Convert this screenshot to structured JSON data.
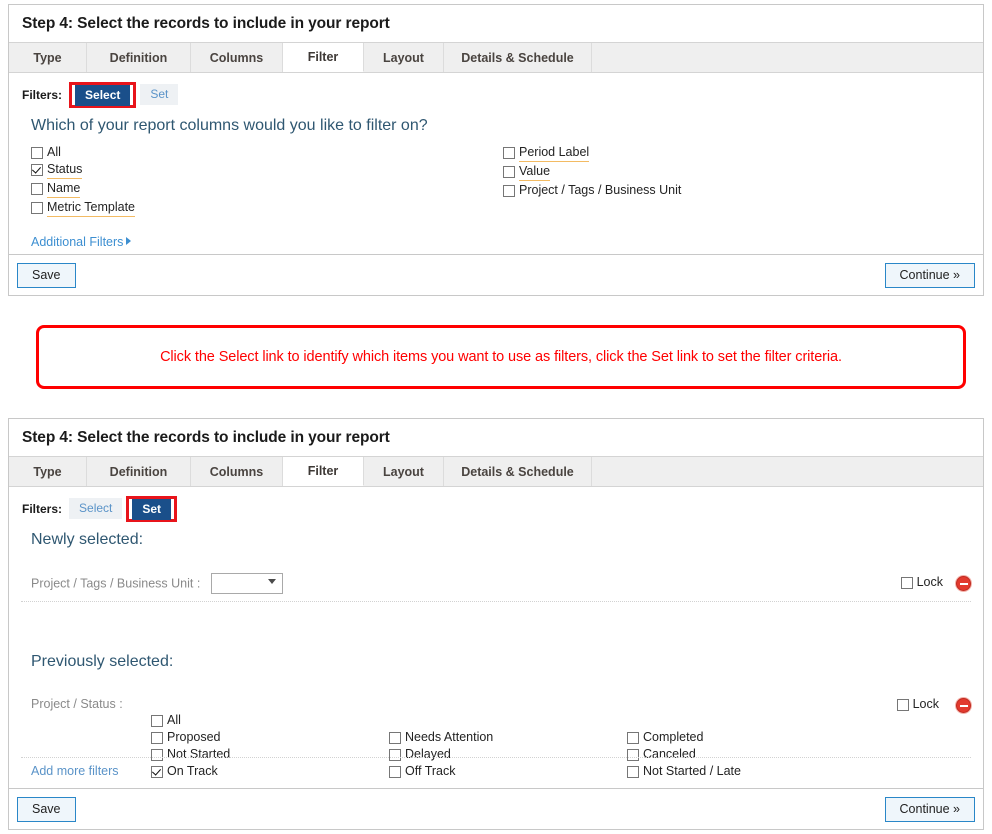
{
  "accent": {
    "tab_bg": "#efefef",
    "active_button": "#1a4f8a",
    "link": "#3d8fd1",
    "heading": "#2f5771",
    "callout_red": "#ff0000",
    "highlight_red": "#e8141b",
    "underline_orange": "#f3bb63",
    "remove_red": "#e23a2e"
  },
  "panel_top": {
    "title": "Step 4: Select the records to include in your report",
    "tabs": [
      {
        "label": "Type",
        "active": false
      },
      {
        "label": "Definition",
        "active": false
      },
      {
        "label": "Columns",
        "active": false
      },
      {
        "label": "Filter",
        "active": true
      },
      {
        "label": "Layout",
        "active": false
      },
      {
        "label": "Details & Schedule",
        "active": false
      }
    ],
    "filters_label": "Filters:",
    "filter_mode_select": "Select",
    "filter_mode_set": "Set",
    "question": "Which of your report columns would you like to filter on?",
    "columns_left": [
      {
        "label": "All",
        "checked": false,
        "underlined": false
      },
      {
        "label": "Status",
        "checked": true,
        "underlined": true
      },
      {
        "label": "Name",
        "checked": false,
        "underlined": true
      },
      {
        "label": "Metric Template",
        "checked": false,
        "underlined": true
      }
    ],
    "columns_right": [
      {
        "label": "Period Label",
        "checked": false,
        "underlined": true
      },
      {
        "label": "Value",
        "checked": false,
        "underlined": true
      },
      {
        "label": "Project / Tags / Business Unit",
        "checked": false,
        "underlined": false
      }
    ],
    "additional_filters": "Additional Filters",
    "save_label": "Save",
    "continue_label": "Continue »"
  },
  "callout": {
    "text": "Click the Select link to identify which items you want to use as filters, click the Set link to set the filter criteria."
  },
  "panel_bottom": {
    "title": "Step 4: Select the records to include in your report",
    "tabs": [
      {
        "label": "Type",
        "active": false
      },
      {
        "label": "Definition",
        "active": false
      },
      {
        "label": "Columns",
        "active": false
      },
      {
        "label": "Filter",
        "active": true
      },
      {
        "label": "Layout",
        "active": false
      },
      {
        "label": "Details & Schedule",
        "active": false
      }
    ],
    "filters_label": "Filters:",
    "filter_mode_select": "Select",
    "filter_mode_set": "Set",
    "newly_selected_heading": "Newly selected:",
    "newly_row": {
      "label": "Project / Tags / Business Unit :",
      "dropdown_value": "",
      "lock_label": "Lock",
      "lock_checked": false
    },
    "previously_selected_heading": "Previously selected:",
    "previously_row": {
      "label": "Project / Status :",
      "lock_label": "Lock",
      "lock_checked": false,
      "status_col1": [
        {
          "label": "All",
          "checked": false
        },
        {
          "label": "Proposed",
          "checked": false
        },
        {
          "label": "Not Started",
          "checked": false
        },
        {
          "label": "On Track",
          "checked": true
        }
      ],
      "status_col2": [
        {
          "label": "Needs Attention",
          "checked": false
        },
        {
          "label": "Delayed",
          "checked": false
        },
        {
          "label": "Off Track",
          "checked": false
        }
      ],
      "status_col3": [
        {
          "label": "Completed",
          "checked": false
        },
        {
          "label": "Canceled",
          "checked": false
        },
        {
          "label": "Not Started / Late",
          "checked": false
        }
      ]
    },
    "add_more_filters": "Add more filters",
    "save_label": "Save",
    "continue_label": "Continue »"
  }
}
